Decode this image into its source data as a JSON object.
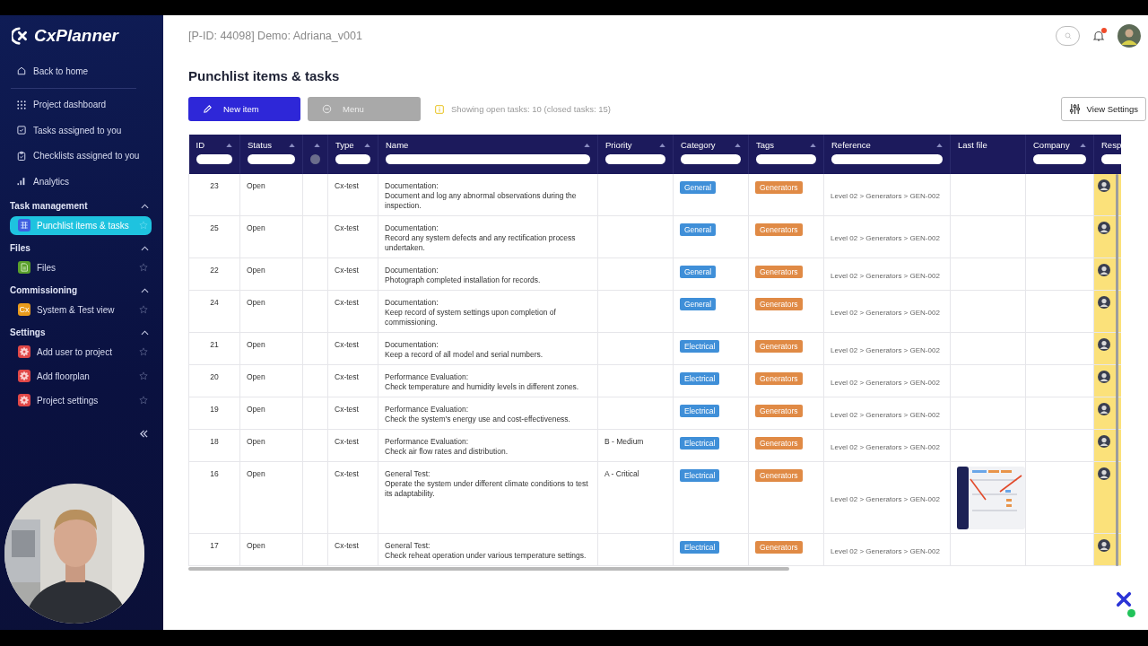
{
  "sidebar": {
    "logo": "CxPlanner",
    "back": "Back to home",
    "nav": [
      {
        "label": "Project dashboard"
      },
      {
        "label": "Tasks assigned to you"
      },
      {
        "label": "Checklists assigned to you"
      },
      {
        "label": "Analytics"
      }
    ],
    "sections": [
      {
        "title": "Task management",
        "expanded": true,
        "items": [
          {
            "label": "Punchlist items & tasks",
            "selected": true,
            "kind": "grid",
            "color": "#3f5fe0"
          }
        ]
      },
      {
        "title": "Files",
        "expanded": true,
        "items": [
          {
            "label": "Files",
            "selected": false,
            "kind": "file",
            "color": "#5aa02c"
          }
        ]
      },
      {
        "title": "Commissioning",
        "expanded": true,
        "items": [
          {
            "label": "System & Test view",
            "selected": false,
            "kind": "text",
            "icon_text": "Cx",
            "color": "#e89a1c"
          }
        ]
      },
      {
        "title": "Settings",
        "expanded": true,
        "items": [
          {
            "label": "Add user to project",
            "selected": false,
            "kind": "gear",
            "color": "#e04848"
          },
          {
            "label": "Add floorplan",
            "selected": false,
            "kind": "gear",
            "color": "#e04848"
          },
          {
            "label": "Project settings",
            "selected": false,
            "kind": "gear",
            "color": "#e04848"
          }
        ]
      }
    ]
  },
  "header": {
    "project": "[P-ID: 44098] Demo: Adriana_v001",
    "notification": true
  },
  "page": {
    "title": "Punchlist items & tasks",
    "buttons": [
      {
        "label": "New item",
        "kind": "primary",
        "disabled": false
      },
      {
        "label": "Menu",
        "kind": "menu",
        "disabled": true
      }
    ],
    "info": "Showing open tasks: 10 (closed tasks: 15)",
    "view_settings": "View Settings"
  },
  "table": {
    "columns": [
      {
        "label": "ID",
        "sortable": true,
        "kind": "text"
      },
      {
        "label": "Status",
        "sortable": true,
        "kind": "text"
      },
      {
        "sortable": true,
        "kind": "toggle"
      },
      {
        "label": "Type",
        "sortable": true,
        "kind": "text"
      },
      {
        "label": "Name",
        "sortable": true,
        "kind": "text"
      },
      {
        "label": "Priority",
        "sortable": true,
        "kind": "text"
      },
      {
        "label": "Category",
        "sortable": true,
        "kind": "text"
      },
      {
        "label": "Tags",
        "sortable": true,
        "kind": "text"
      },
      {
        "label": "Reference",
        "sortable": true,
        "kind": "text"
      },
      {
        "label": "Last file",
        "sortable": false,
        "kind": "file"
      },
      {
        "label": "Company",
        "sortable": true,
        "kind": "text"
      },
      {
        "label": "Resp",
        "sortable": false,
        "kind": "text"
      }
    ],
    "rows": [
      {
        "id": "23",
        "status": "Open",
        "type": "Cx-test",
        "heading": "Documentation:",
        "name": "Document and log any abnormal observations during the inspection.",
        "category": "General",
        "tag": "Generators",
        "reference": "Level 02 > Generators > GEN-002"
      },
      {
        "id": "25",
        "status": "Open",
        "type": "Cx-test",
        "heading": "Documentation:",
        "name": "Record any system defects and any rectification process undertaken.",
        "category": "General",
        "tag": "Generators",
        "reference": "Level 02 > Generators > GEN-002"
      },
      {
        "id": "22",
        "status": "Open",
        "type": "Cx-test",
        "heading": "Documentation:",
        "name": "Photograph completed installation for records.",
        "category": "General",
        "tag": "Generators",
        "reference": "Level 02 > Generators > GEN-002"
      },
      {
        "id": "24",
        "status": "Open",
        "type": "Cx-test",
        "heading": "Documentation:",
        "name": "Keep record of system settings upon completion of commissioning.",
        "category": "General",
        "tag": "Generators",
        "reference": "Level 02 > Generators > GEN-002"
      },
      {
        "id": "21",
        "status": "Open",
        "type": "Cx-test",
        "heading": "Documentation:",
        "name": "Keep a record of all model and serial numbers.",
        "category": "Electrical",
        "tag": "Generators",
        "reference": "Level 02 > Generators > GEN-002"
      },
      {
        "id": "20",
        "status": "Open",
        "type": "Cx-test",
        "heading": "Performance Evaluation:",
        "name": "Check temperature and humidity levels in different zones.",
        "category": "Electrical",
        "tag": "Generators",
        "reference": "Level 02 > Generators > GEN-002"
      },
      {
        "id": "19",
        "status": "Open",
        "type": "Cx-test",
        "heading": "Performance Evaluation:",
        "name": "Check the system's energy use and cost-effectiveness.",
        "category": "Electrical",
        "tag": "Generators",
        "reference": "Level 02 > Generators > GEN-002"
      },
      {
        "id": "18",
        "status": "Open",
        "type": "Cx-test",
        "heading": "Performance Evaluation:",
        "name": "Check air flow rates and distribution.",
        "priority": "B - Medium",
        "category": "Electrical",
        "tag": "Generators",
        "reference": "Level 02 > Generators > GEN-002"
      },
      {
        "id": "16",
        "status": "Open",
        "type": "Cx-test",
        "heading": "General Test:",
        "name": "Operate the system under different climate conditions to test its adaptability.",
        "priority": "A - Critical",
        "category": "Electrical",
        "tag": "Generators",
        "reference": "Level 02 > Generators > GEN-002"
      },
      {
        "id": "17",
        "status": "Open",
        "type": "Cx-test",
        "heading": "General Test:",
        "name": "Check reheat operation under various temperature settings.",
        "category": "Electrical",
        "tag": "Generators",
        "reference": "Level 02 > Generators > GEN-002"
      }
    ]
  }
}
